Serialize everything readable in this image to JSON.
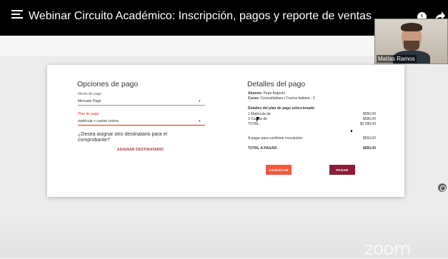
{
  "header": {
    "title": "Webinar Circuito Académico: Inscripción, pagos y reporte de ventas"
  },
  "video": {
    "participant_name": "Matías Ramos"
  },
  "payment_options": {
    "heading": "Opciones de pago",
    "medio_label": "Medio de pago",
    "medio_value": "Mercado Pago",
    "plan_label": "Plan de pago",
    "plan_value": "matrícula + cuotas cocina",
    "question": "¿Desea asignar otro destinatario para el comprobante?",
    "assign_link": "ASIGNAR DESTINATARIO"
  },
  "payment_details": {
    "heading": "Detalles del pago",
    "alumno_label": "Alumno:",
    "alumno_value": "Pepe Argento",
    "curso_label": "Curso:",
    "curso_value": "CocinaItaliana | Cocina Italiana - C",
    "plan_title": "Detalles del plan de pago seleccionado",
    "items": [
      {
        "label": "1 Matrícula de",
        "amount": "$550,00"
      },
      {
        "label": "3 Cuotas de",
        "amount": "$580,00"
      },
      {
        "label": "TOTAL",
        "amount": "$2.290,00"
      }
    ],
    "confirm_label": "A pagar para confirmar inscripción:",
    "confirm_amount": "$550,00",
    "total_label": "TOTAL A PAGAR:",
    "total_amount": "$550,00"
  },
  "buttons": {
    "cancel": "CANCELAR",
    "pay": "PAGAR"
  },
  "zoom_logo": "zoom"
}
